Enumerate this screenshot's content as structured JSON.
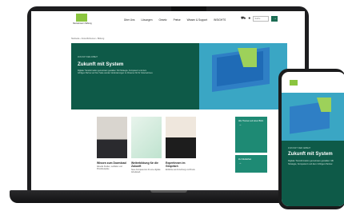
{
  "site": {
    "logo_text": "Bertelsmann Stiftung",
    "nav": [
      "Über Uns",
      "Lösungen",
      "Gesetz",
      "Preise",
      "Wissen & Support",
      "INSIGHTS"
    ],
    "search_placeholder": "Suche",
    "search_button": "→"
  },
  "breadcrumb": "Startseite › Zukunftsthemen › Bildung",
  "hero": {
    "kicker": "ZUKUNFT DER ARBEIT",
    "title": "Zukunft mit System",
    "text": "Digitale Transformation gemeinsam gestalten: Mit Strategie, Kompetenz und dem richtigen Partner an Ihrer Seite werden Veränderungen zu Chancen für Ihr Unternehmen."
  },
  "cards": [
    {
      "title": "Wissen zum Download",
      "text": "Aktuelle Studien, Leitfäden und Praxisbeispiele."
    },
    {
      "title": "Weiterbildung für die Zukunft",
      "text": "Neue Kompetenzen für eine digitale Arbeitswelt."
    },
    {
      "title": "Expertinnen im Gespräch",
      "text": "Einblicke aus Forschung und Praxis."
    }
  ],
  "side_boxes": [
    {
      "text": "Alle Themen auf einen Blick",
      "arrow": "→"
    },
    {
      "text": "Zur Mediathek",
      "arrow": "→"
    }
  ],
  "phone": {
    "kicker": "ZUKUNFT DER ARBEIT",
    "title": "Zukunft mit System",
    "text": "Digitale Transformation gemeinsam gestalten: Mit Strategie, Kompetenz und dem richtigen Partner."
  }
}
